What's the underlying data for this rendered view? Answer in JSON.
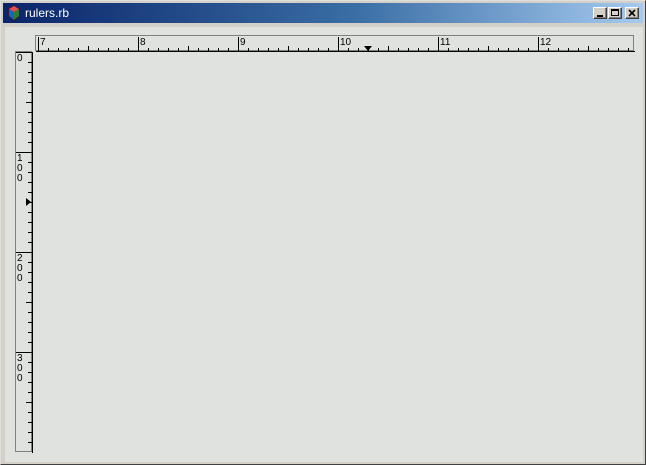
{
  "window": {
    "title": "rulers.rb",
    "controls": [
      "minimize",
      "maximize",
      "close"
    ]
  },
  "icons": {
    "app": "ruby-app-icon",
    "minimize": "minimize-icon",
    "maximize": "maximize-icon",
    "close": "close-icon"
  },
  "rulers": {
    "horizontal": {
      "labels": [
        "7",
        "8",
        "9",
        "10",
        "11",
        "12"
      ],
      "marker_value": 10.3
    },
    "vertical": {
      "labels": [
        "0",
        "100",
        "200",
        "300"
      ],
      "marker_value": 150
    }
  },
  "colors": {
    "canvas_background": "#dfe2df",
    "titlebar_start": "#0a246a",
    "titlebar_end": "#a6caf0"
  }
}
